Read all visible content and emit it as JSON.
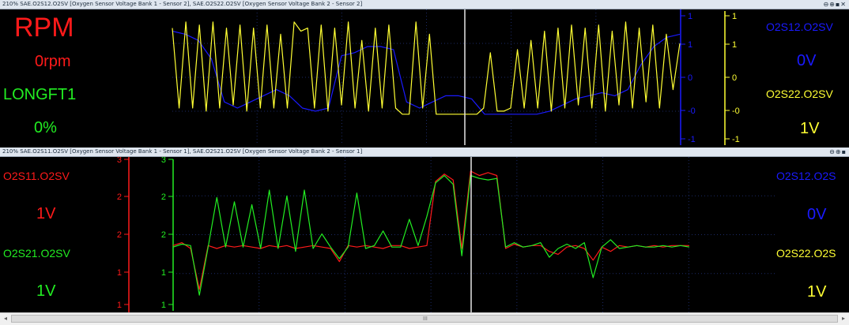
{
  "panel1": {
    "title": "210% SAE.O2S12.O2SV [Oxygen Sensor Voltage Bank 1 - Sensor 2], SAE.O2S22.O2SV [Oxygen Sensor Voltage Bank 2 - Sensor 2]",
    "window_controls": "⊖⊕▪✕",
    "left_readouts": [
      {
        "name": "RPM",
        "value": "0rpm",
        "color": "#ff1a1a"
      },
      {
        "name": "LONGFT1",
        "value": "0%",
        "color": "#22ee22"
      }
    ],
    "right_readouts": [
      {
        "name": "O2S12.O2SV",
        "value": "0V",
        "color": "#1a1aff"
      },
      {
        "name": "O2S22.O2SV",
        "value": "1V",
        "color": "#ffff33"
      }
    ],
    "blue_axis_ticks": [
      "1",
      "1",
      "0",
      "-0",
      "-1"
    ],
    "yellow_axis_ticks": [
      "1",
      "1",
      "0",
      "-0",
      "-1"
    ]
  },
  "panel2": {
    "title": "210% SAE.O2S11.O2SV [Oxygen Sensor Voltage Bank 1 - Sensor 1], SAE.O2S21.O2SV [Oxygen Sensor Voltage Bank 2 - Sensor 1]",
    "window_controls": "⊖⊕▪",
    "left_readouts": [
      {
        "name": "O2S11.O2SV",
        "value": "1V",
        "color": "#ff1a1a"
      },
      {
        "name": "O2S21.O2SV",
        "value": "1V",
        "color": "#22ee22"
      }
    ],
    "right_readouts": [
      {
        "name": "O2S12.O2S",
        "value": "0V",
        "color": "#1a1aff"
      },
      {
        "name": "O2S22.O2S",
        "value": "1V",
        "color": "#ffff33"
      }
    ],
    "red_axis_ticks": [
      "3",
      "2",
      "2",
      "1",
      "1"
    ],
    "green_axis_ticks": [
      "3",
      "2",
      "2",
      "1",
      "1"
    ]
  },
  "scrollbar": {
    "left_arrow": "◂",
    "right_arrow": "▸",
    "grip": "III"
  },
  "colors": {
    "red": "#ff1a1a",
    "green": "#22ee22",
    "blue": "#1a1aff",
    "yellow": "#ffff33",
    "grid": "#1c2a66",
    "cursor": "#e6e6e6"
  },
  "chart_data": [
    {
      "type": "line",
      "title": "",
      "xlabel": "",
      "ylabel": "",
      "grid": true,
      "ylim": [
        -1,
        1
      ],
      "series": [
        {
          "name": "O2S12.O2SV",
          "color": "#1a1aff",
          "values": [
            0.75,
            0.7,
            0.6,
            0.3,
            -0.4,
            -0.5,
            -0.4,
            -0.3,
            -0.2,
            -0.3,
            -0.5,
            -0.55,
            -0.5,
            0.35,
            0.4,
            0.5,
            0.5,
            0.45,
            -0.4,
            -0.5,
            -0.4,
            -0.3,
            -0.3,
            -0.35,
            -0.6,
            -0.6,
            -0.6,
            -0.6,
            -0.6,
            -0.55,
            -0.45,
            -0.35,
            -0.3,
            -0.25,
            -0.3,
            -0.2,
            0.2,
            0.5,
            0.65,
            0.7
          ]
        },
        {
          "name": "O2S22.O2SV",
          "color": "#ffff33",
          "values": [
            0.8,
            -0.5,
            0.9,
            -0.5,
            0.85,
            -0.55,
            0.9,
            -0.5,
            0.8,
            -0.45,
            0.85,
            -0.55,
            0.8,
            -0.5,
            0.85,
            -0.5,
            0.7,
            -0.5,
            0.9,
            0.75,
            0.8,
            -0.5,
            0.85,
            -0.55,
            0.8,
            -0.45,
            0.9,
            -0.5,
            0.6,
            -0.55,
            0.8,
            -0.5,
            0.85,
            -0.5,
            -0.6,
            -0.6,
            0.9,
            -0.5,
            0.7,
            -0.6,
            -0.6,
            -0.6,
            -0.6,
            -0.6,
            -0.6,
            -0.6,
            -0.5,
            0.4,
            -0.55,
            -0.55,
            -0.5,
            0.45,
            -0.5,
            0.6,
            -0.5,
            0.75,
            -0.55,
            0.8,
            -0.5,
            0.85,
            -0.45,
            0.8,
            -0.5,
            0.85,
            -0.55,
            0.75,
            -0.45,
            0.9,
            -0.5,
            0.8,
            -0.4,
            0.85,
            -0.5,
            0.7,
            -0.2,
            0.55
          ]
        }
      ]
    },
    {
      "type": "line",
      "title": "",
      "xlabel": "",
      "ylabel": "",
      "grid": true,
      "ylim": [
        0,
        1
      ],
      "series": [
        {
          "name": "O2S11.O2SV",
          "color": "#ff1a1a",
          "values": [
            0.42,
            0.44,
            0.4,
            0.12,
            0.42,
            0.4,
            0.42,
            0.41,
            0.42,
            0.41,
            0.4,
            0.42,
            0.41,
            0.42,
            0.4,
            0.41,
            0.42,
            0.41,
            0.4,
            0.31,
            0.42,
            0.41,
            0.42,
            0.41,
            0.4,
            0.42,
            0.42,
            0.4,
            0.41,
            0.42,
            0.86,
            0.91,
            0.87,
            0.4,
            0.93,
            0.9,
            0.92,
            0.9,
            0.4,
            0.43,
            0.41,
            0.42,
            0.42,
            0.38,
            0.36,
            0.41,
            0.42,
            0.4,
            0.32,
            0.41,
            0.38,
            0.42,
            0.41,
            0.42,
            0.41,
            0.42,
            0.41,
            0.42,
            0.42,
            0.42
          ]
        },
        {
          "name": "O2S21.O2SV",
          "color": "#22ee22",
          "values": [
            0.41,
            0.43,
            0.42,
            0.08,
            0.41,
            0.75,
            0.41,
            0.72,
            0.41,
            0.7,
            0.4,
            0.8,
            0.4,
            0.76,
            0.38,
            0.8,
            0.4,
            0.5,
            0.41,
            0.33,
            0.41,
            0.78,
            0.4,
            0.42,
            0.52,
            0.41,
            0.41,
            0.6,
            0.42,
            0.62,
            0.85,
            0.9,
            0.84,
            0.35,
            0.9,
            0.88,
            0.87,
            0.88,
            0.41,
            0.44,
            0.41,
            0.42,
            0.44,
            0.34,
            0.4,
            0.43,
            0.4,
            0.44,
            0.2,
            0.41,
            0.46,
            0.4,
            0.41,
            0.42,
            0.41,
            0.41,
            0.42,
            0.41,
            0.42,
            0.41
          ]
        }
      ]
    }
  ]
}
